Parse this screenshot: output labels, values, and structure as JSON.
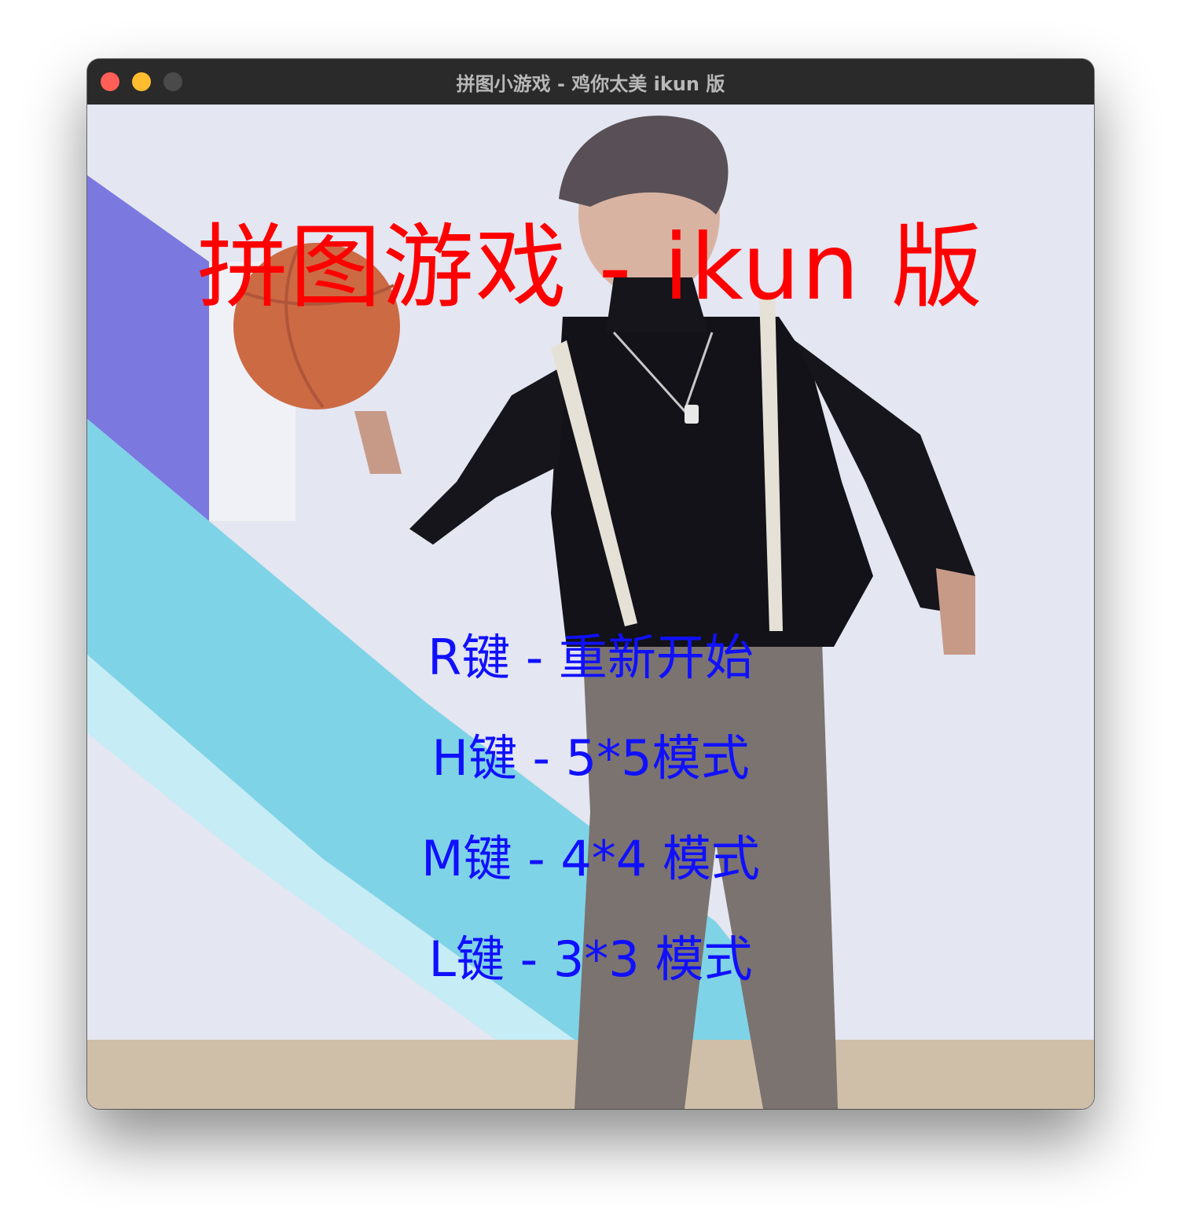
{
  "window": {
    "title": "拼图小游戏 - 鸡你太美 ikun 版"
  },
  "canvas": {
    "headline": "拼图游戏 - ikun 版",
    "menu": [
      "R键 - 重新开始",
      "H键 - 5*5模式",
      "M键 - 4*4 模式",
      "L键 - 3*3 模式"
    ],
    "colors": {
      "headline": "#ff0000",
      "menu": "#1010ff"
    }
  }
}
